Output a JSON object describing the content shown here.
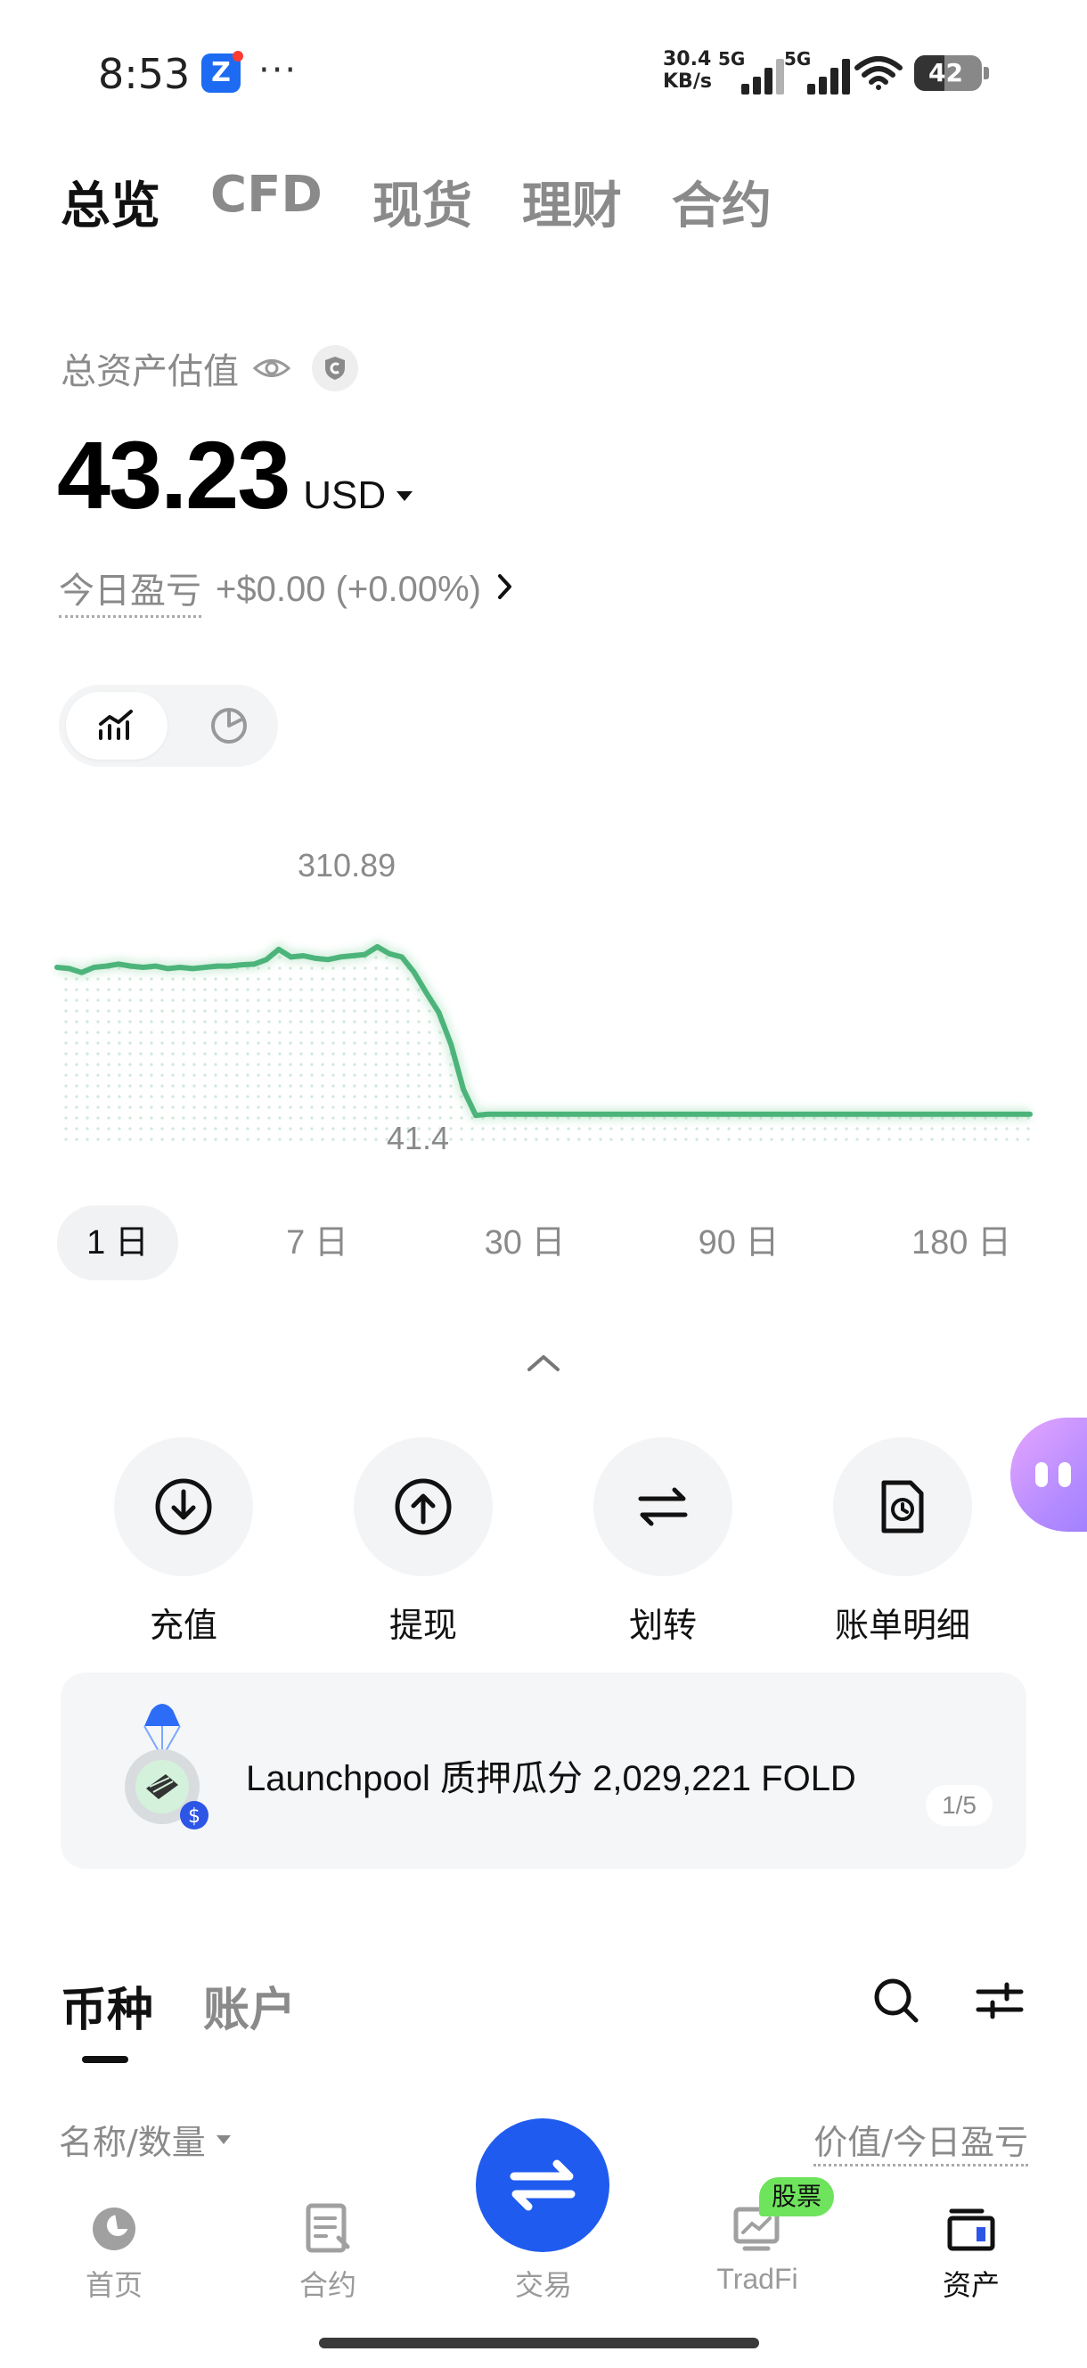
{
  "status_bar": {
    "time": "8:53",
    "app_icon_letter": "Z",
    "more": "···",
    "net_speed_value": "30.4",
    "net_speed_unit": "KB/s",
    "signal1_label": "5G",
    "signal2_label": "5G",
    "battery": "42",
    "icons": [
      "app-notification-icon",
      "signal-icon",
      "wifi-icon",
      "battery-icon"
    ]
  },
  "top_tabs": [
    {
      "label": "总览",
      "active": true
    },
    {
      "label": "CFD",
      "active": false
    },
    {
      "label": "现货",
      "active": false
    },
    {
      "label": "理财",
      "active": false
    },
    {
      "label": "合约",
      "active": false
    }
  ],
  "summary": {
    "label": "总资产估值",
    "value": "43.23",
    "currency": "USD",
    "pnl_label": "今日盈亏",
    "pnl_value": "+$0.00 (+0.00%)"
  },
  "chart_data": {
    "type": "line",
    "max_label": "310.89",
    "min_label": "41.4",
    "color": "#4cb47a",
    "ylim": [
      0,
      360
    ],
    "values": [
      270,
      268,
      262,
      270,
      272,
      275,
      272,
      270,
      272,
      268,
      270,
      268,
      270,
      272,
      272,
      274,
      275,
      282,
      298,
      286,
      288,
      284,
      282,
      286,
      288,
      290,
      302,
      291,
      286,
      262,
      230,
      200,
      150,
      80,
      40,
      42,
      42,
      42,
      42,
      42,
      42,
      42,
      42,
      42,
      42,
      42,
      42,
      42,
      42,
      42,
      42,
      42,
      42,
      42,
      42,
      42,
      42,
      42,
      42,
      42,
      42,
      42,
      42,
      42,
      42,
      42,
      42,
      42,
      42,
      42,
      42,
      42,
      42,
      42,
      42,
      42,
      42,
      42,
      42,
      42
    ]
  },
  "ranges": [
    {
      "label": "1 日",
      "active": true
    },
    {
      "label": "7 日",
      "active": false
    },
    {
      "label": "30 日",
      "active": false
    },
    {
      "label": "90 日",
      "active": false
    },
    {
      "label": "180 日",
      "active": false
    }
  ],
  "actions": [
    {
      "label": "充值",
      "icon": "deposit-icon"
    },
    {
      "label": "提现",
      "icon": "withdraw-icon"
    },
    {
      "label": "划转",
      "icon": "transfer-icon"
    },
    {
      "label": "账单明细",
      "icon": "bill-icon"
    }
  ],
  "banner": {
    "text": "Launchpool 质押瓜分 2,029,221 FOLD",
    "page": "1/5",
    "icon": "launchpool-icon"
  },
  "holdings": {
    "tabs": [
      {
        "label": "币种",
        "active": true
      },
      {
        "label": "账户",
        "active": false
      }
    ],
    "col_left": "名称/数量",
    "col_right": "价值/今日盈亏"
  },
  "nav": [
    {
      "label": "首页",
      "icon": "home-icon",
      "active": false
    },
    {
      "label": "合约",
      "icon": "contract-icon",
      "active": false
    },
    {
      "label": "交易",
      "icon": "trade-icon",
      "active": false
    },
    {
      "label": "TradFi",
      "icon": "tradfi-icon",
      "active": false,
      "badge": "股票"
    },
    {
      "label": "资产",
      "icon": "assets-icon",
      "active": true
    }
  ]
}
